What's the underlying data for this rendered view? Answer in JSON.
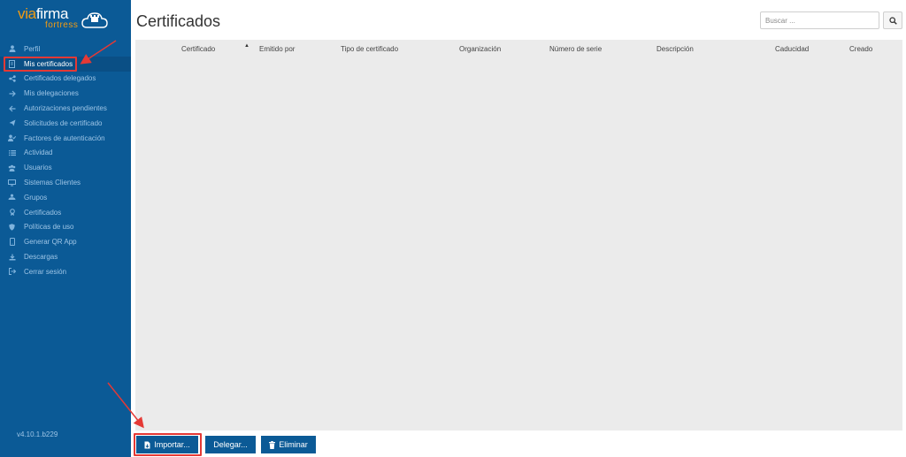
{
  "brand": {
    "via": "via",
    "firma": "firma",
    "sub": "fortress"
  },
  "sidebar": {
    "items": [
      {
        "label": "Perfil",
        "icon": "user-icon"
      },
      {
        "label": "Mis certificados",
        "icon": "certificate-icon",
        "active": true
      },
      {
        "label": "Certificados delegados",
        "icon": "share-icon"
      },
      {
        "label": "Mis delegaciones",
        "icon": "arrow-right-icon"
      },
      {
        "label": "Autorizaciones pendientes",
        "icon": "arrow-left-icon"
      },
      {
        "label": "Solicitudes de certificado",
        "icon": "send-icon"
      },
      {
        "label": "Factores de autenticación",
        "icon": "user-check-icon"
      },
      {
        "label": "Actividad",
        "icon": "list-icon"
      },
      {
        "label": "Usuarios",
        "icon": "users-icon"
      },
      {
        "label": "Sistemas Clientes",
        "icon": "monitor-icon"
      },
      {
        "label": "Grupos",
        "icon": "group-icon"
      },
      {
        "label": "Certificados",
        "icon": "award-icon"
      },
      {
        "label": "Políticas de uso",
        "icon": "shield-icon"
      },
      {
        "label": "Generar QR App",
        "icon": "mobile-icon"
      },
      {
        "label": "Descargas",
        "icon": "download-icon"
      },
      {
        "label": "Cerrar sesión",
        "icon": "logout-icon"
      }
    ],
    "version": "v4.10.1.b229"
  },
  "main": {
    "title": "Certificados",
    "search_placeholder": "Buscar ...",
    "columns": [
      "Certificado",
      "Emitido por",
      "Tipo de certificado",
      "Organización",
      "Número de serie",
      "Descripción",
      "Caducidad",
      "Creado"
    ]
  },
  "actions": {
    "import_label": "Importar...",
    "delegate_label": "Delegar...",
    "delete_label": "Eliminar"
  },
  "colors": {
    "sidebar_bg": "#0b5a96",
    "button_bg": "#0b5a96",
    "highlight": "#e53935",
    "brand_orange": "#f39c12"
  }
}
